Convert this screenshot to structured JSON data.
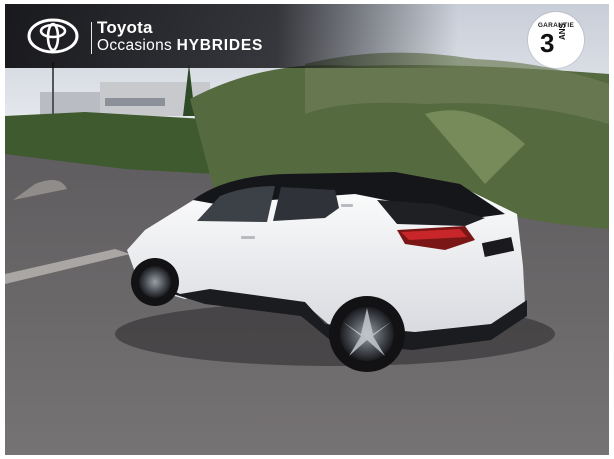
{
  "brand": {
    "name": "Toyota",
    "line_prefix": "Occasions",
    "line_highlight": "HYBRIDES"
  },
  "badge": {
    "top_text": "GARANTIE",
    "number": "3",
    "unit": "ANS"
  },
  "colors": {
    "band": "#0a0a0e",
    "car_body": "#f2f2f4",
    "car_roof": "#15161a",
    "asphalt": "#6d6a6b"
  },
  "icons": {
    "logo": "toyota-logo"
  }
}
